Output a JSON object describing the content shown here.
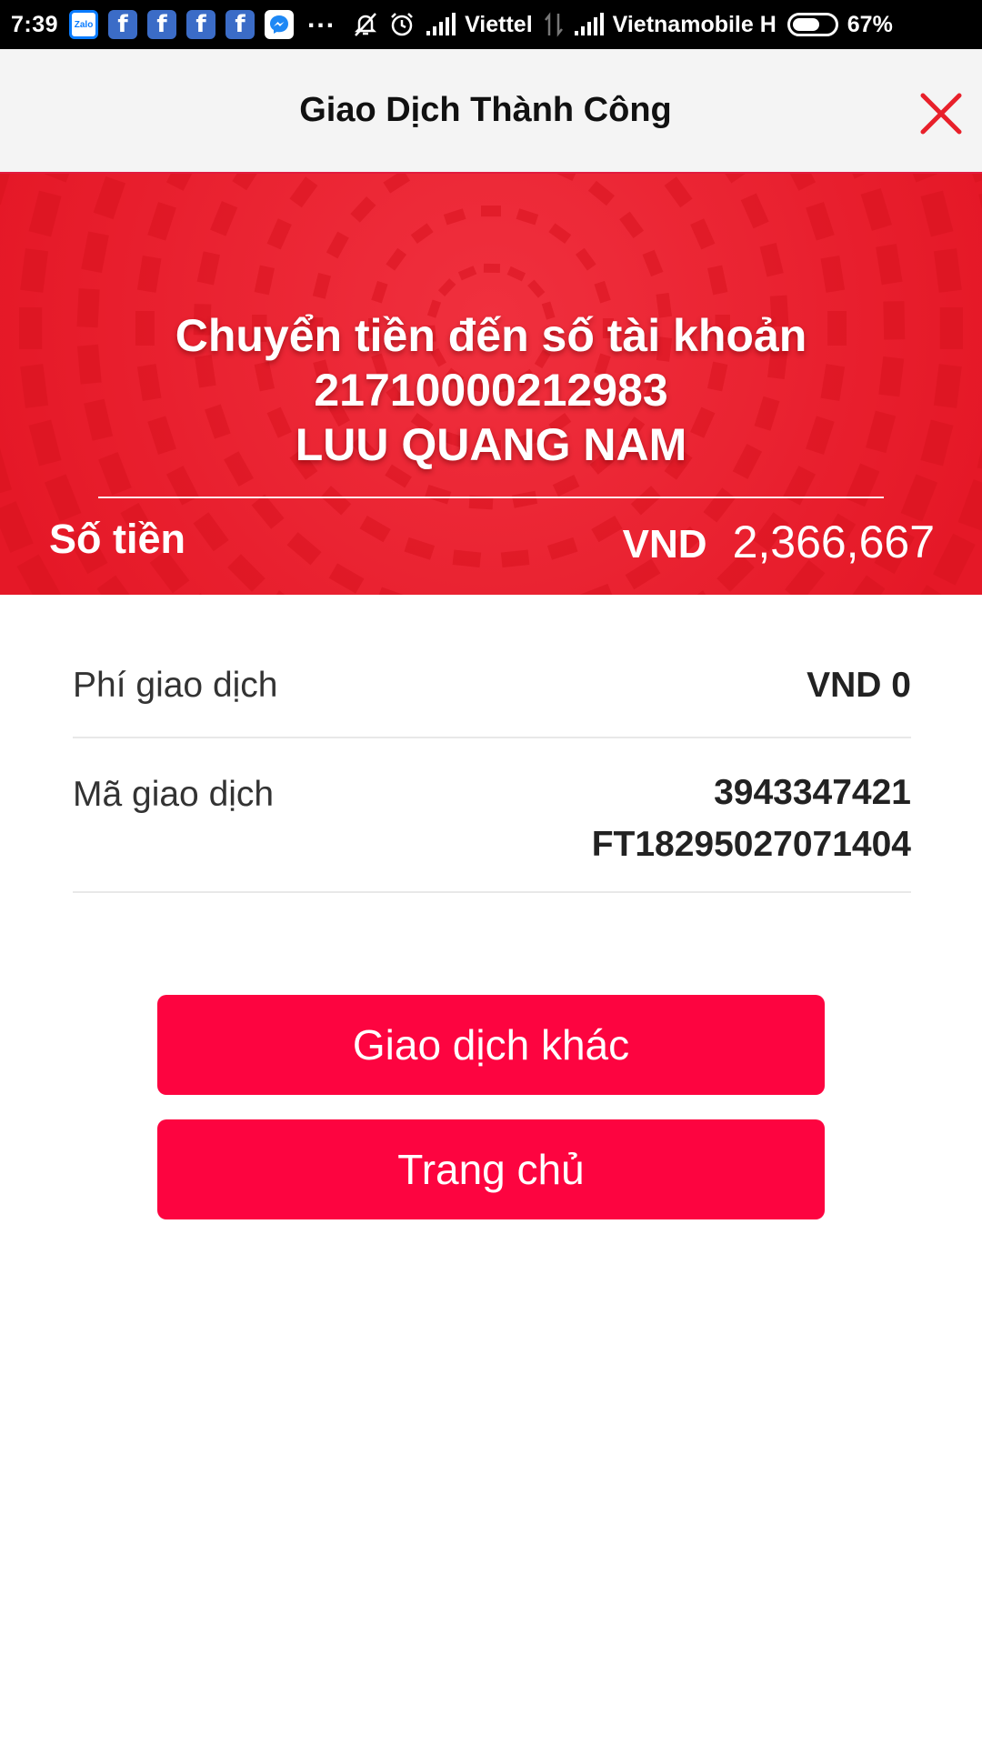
{
  "status_bar": {
    "time": "7:39",
    "notification_icons": [
      "zalo-icon",
      "facebook-icon",
      "facebook-icon",
      "facebook-icon",
      "facebook-icon",
      "messenger-icon"
    ],
    "zalo_label": "Zalo",
    "facebook_label": "f",
    "more": "...",
    "carrier_1": "Viettel",
    "carrier_2": "Vietnamobile H",
    "battery_percent": "67%",
    "battery_level": 0.67
  },
  "header": {
    "title": "Giao Dịch Thành Công",
    "close_icon": "close-icon"
  },
  "banner": {
    "line1": "Chuyển tiền đến số tài khoản",
    "account_number": "21710000212983",
    "account_name": "LUU QUANG NAM",
    "amount_label": "Số tiền",
    "currency": "VND",
    "amount": "2,366,667"
  },
  "details": {
    "fee_label": "Phí giao dịch",
    "fee_value": "VND 0",
    "code_label": "Mã giao dịch",
    "code_value_1": "3943347421",
    "code_value_2": "FT18295027071404"
  },
  "buttons": {
    "other_transaction": "Giao dịch khác",
    "home": "Trang chủ"
  },
  "colors": {
    "brand_red": "#ea1b2b",
    "button_red": "#fd0440",
    "close_icon_red": "#e8202a",
    "header_bg": "#f4f4f4"
  }
}
